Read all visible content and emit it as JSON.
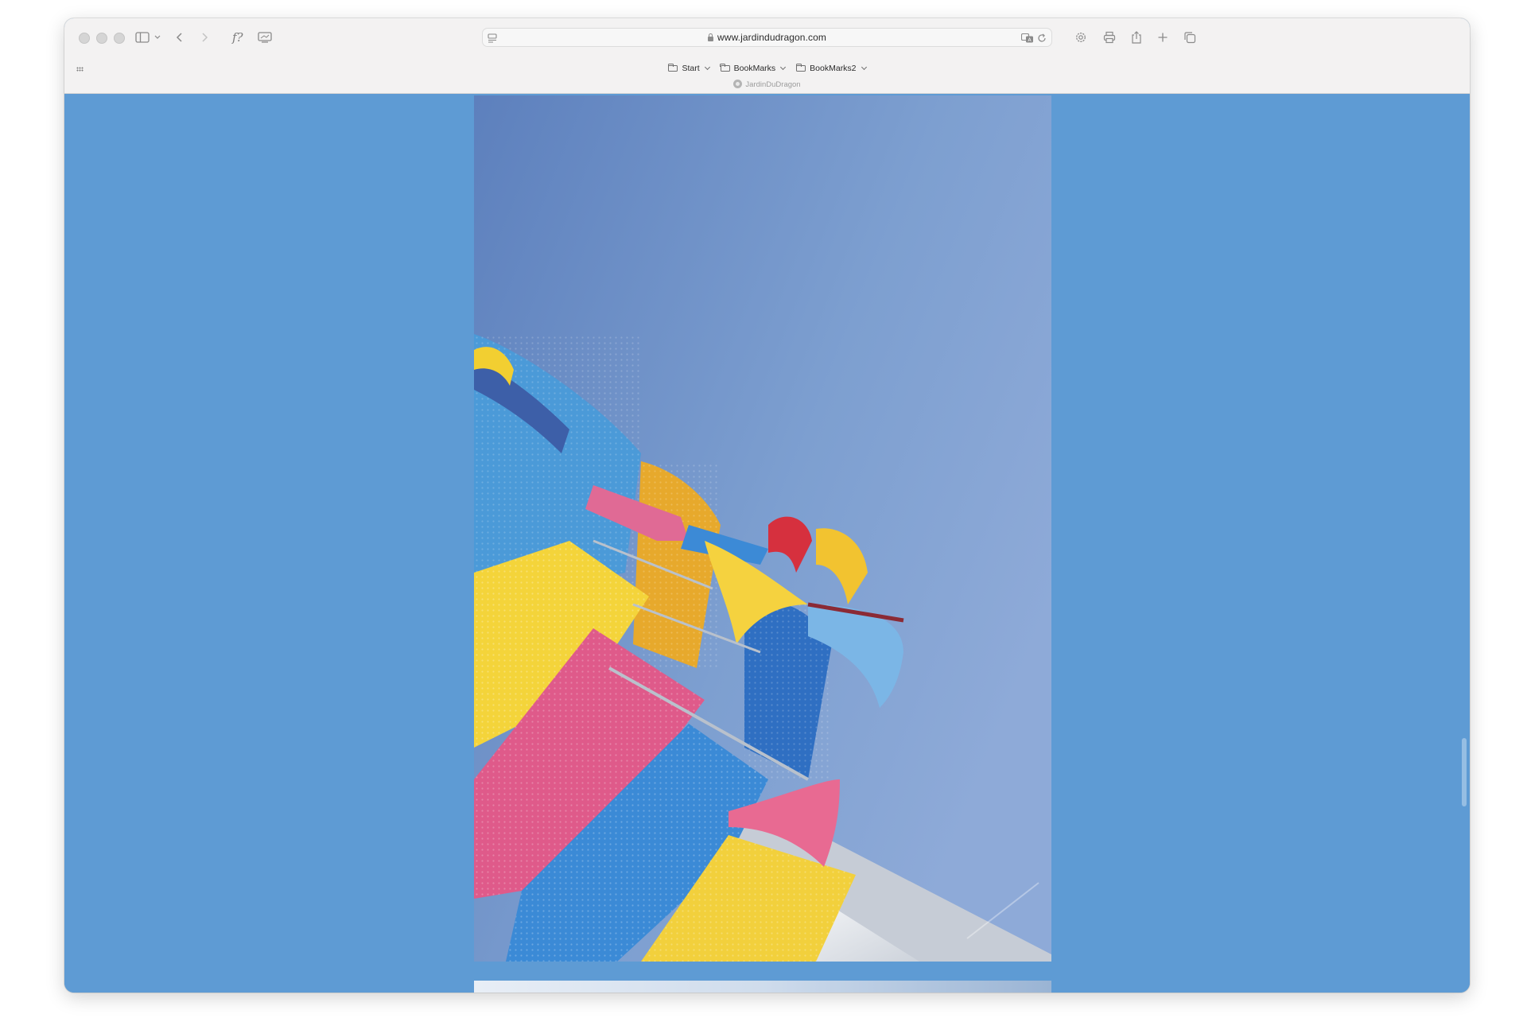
{
  "browser": {
    "url": "www.jardindudragon.com",
    "formula_label": "f?",
    "tab_title": "JardinDuDragon",
    "bookmarks": [
      {
        "label": "Start"
      },
      {
        "label": "BookMarks"
      },
      {
        "label": "BookMarks2"
      }
    ]
  },
  "page": {
    "background_color": "#5e9bd4",
    "photo_description_icon": "photo"
  }
}
